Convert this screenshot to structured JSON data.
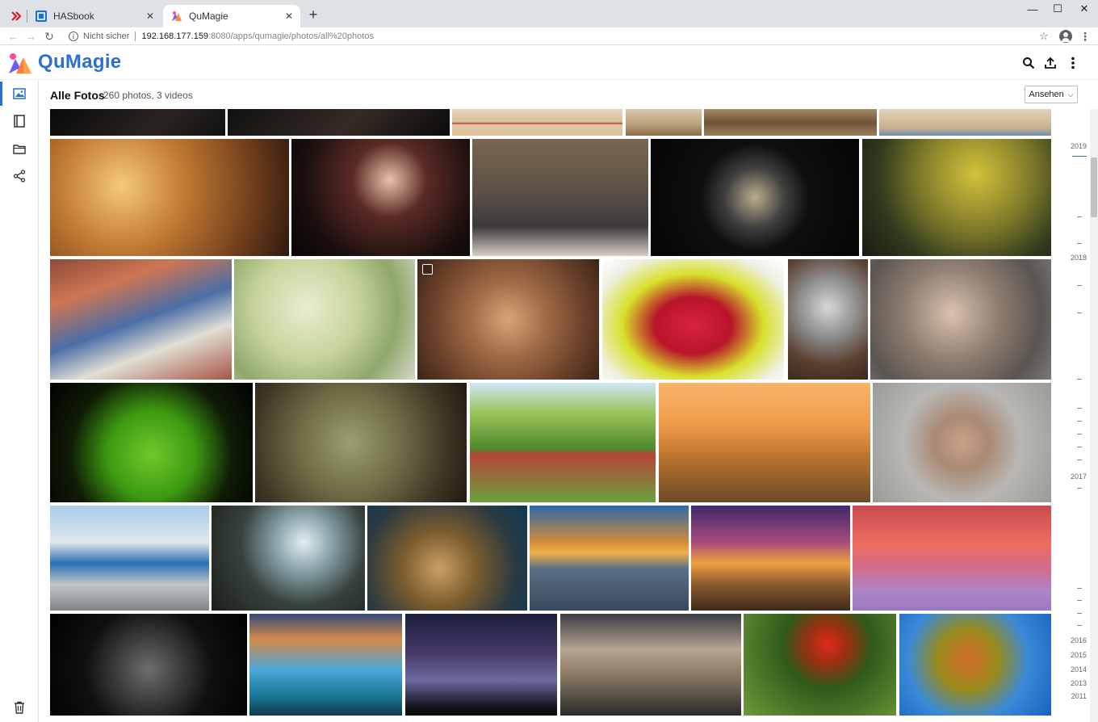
{
  "browser": {
    "tabs": [
      {
        "title": "",
        "favicon": "red-x-logo"
      },
      {
        "title": "HASbook",
        "favicon": "blue-square-logo"
      },
      {
        "title": "QuMagie",
        "favicon": "qumagie-logo",
        "active": true
      }
    ],
    "not_secure": "Nicht sicher",
    "url_host": "192.168.177.159",
    "url_rest": ":8080/apps/qumagie/photos/all%20photos"
  },
  "app": {
    "name": "QuMagie",
    "brand_color": "#2b6fd6",
    "header_icons": [
      "search-icon",
      "upload-icon",
      "more-vert-icon"
    ]
  },
  "nav": {
    "items": [
      "photos-icon",
      "album-icon",
      "folder-icon",
      "share-icon"
    ],
    "active": "photos-icon",
    "bottom": "trash-icon"
  },
  "content": {
    "title": "Alle Fotos",
    "count": "260 photos, 3 videos",
    "view_button": "Ansehen"
  },
  "timeline": {
    "years": [
      "2019",
      "2018",
      "2017",
      "2016",
      "2015",
      "2014",
      "2013",
      "2011"
    ]
  },
  "photos": [
    {
      "subject": "dark hair portrait",
      "row": 0
    },
    {
      "subject": "dark portrait",
      "row": 0
    },
    {
      "subject": "red dress on beach",
      "row": 0
    },
    {
      "subject": "legs on boardwalk",
      "row": 0
    },
    {
      "subject": "wooden boardwalk",
      "row": 0
    },
    {
      "subject": "feet on sand",
      "row": 0
    },
    {
      "subject": "woman with flower",
      "row": 1
    },
    {
      "subject": "woman in fur coat",
      "row": 1
    },
    {
      "subject": "couple with pug",
      "row": 1
    },
    {
      "subject": "pocket watch",
      "row": 1
    },
    {
      "subject": "lizard on rock",
      "row": 1
    },
    {
      "subject": "colorful city rooftops",
      "row": 2
    },
    {
      "subject": "striped mug",
      "row": 2
    },
    {
      "subject": "coins",
      "row": 2
    },
    {
      "subject": "strawberries in bowl",
      "row": 2
    },
    {
      "subject": "cat",
      "row": 2
    },
    {
      "subject": "woman with sweater",
      "row": 2
    },
    {
      "subject": "kermit frogs",
      "row": 3
    },
    {
      "subject": "old map with compass",
      "row": 3
    },
    {
      "subject": "apple tree",
      "row": 3
    },
    {
      "subject": "couple at sunset",
      "row": 3
    },
    {
      "subject": "angry woman steam",
      "row": 3
    },
    {
      "subject": "classic blue car",
      "row": 4
    },
    {
      "subject": "sled dogs",
      "row": 4
    },
    {
      "subject": "car interior",
      "row": 4
    },
    {
      "subject": "mountain sunset",
      "row": 4
    },
    {
      "subject": "tree at sunset",
      "row": 4
    },
    {
      "subject": "pink winter field",
      "row": 4
    },
    {
      "subject": "wristwatch",
      "row": 5
    },
    {
      "subject": "waterfall",
      "row": 5
    },
    {
      "subject": "starry night",
      "row": 5
    },
    {
      "subject": "bridge",
      "row": 5
    },
    {
      "subject": "red poppy",
      "row": 5
    },
    {
      "subject": "autumn leaves",
      "row": 5
    }
  ]
}
